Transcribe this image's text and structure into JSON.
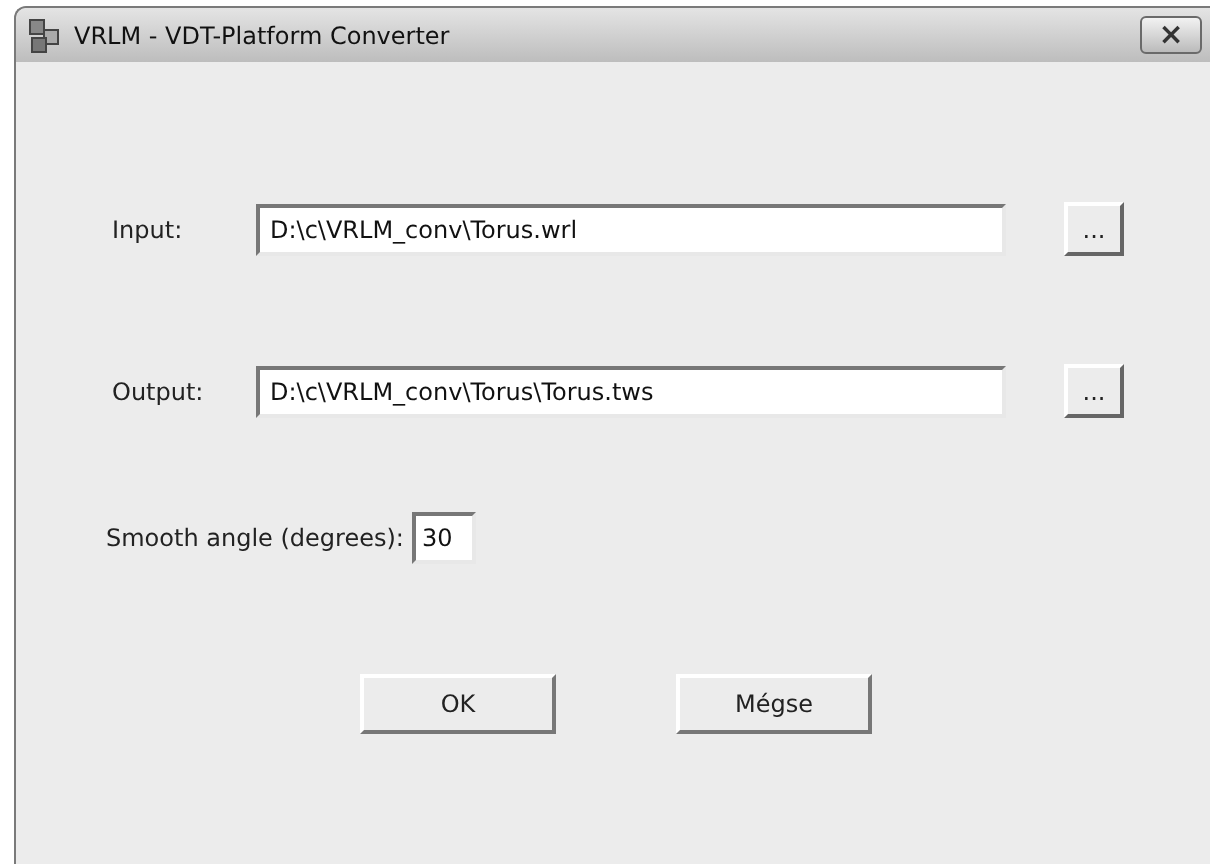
{
  "window": {
    "title": "VRLM - VDT-Platform Converter",
    "close": "×"
  },
  "fields": [
    {
      "label": "Input:",
      "value": "D:\\c\\VRLM_conv\\Torus.wrl",
      "browse": "..."
    },
    {
      "label": "Output:",
      "value": "D:\\c\\VRLM_conv\\Torus\\Torus.tws",
      "browse": "..."
    }
  ],
  "smooth_angle": {
    "label": "Smooth angle (degrees):",
    "value": "30"
  },
  "buttons": [
    "OK",
    "Mégse"
  ]
}
